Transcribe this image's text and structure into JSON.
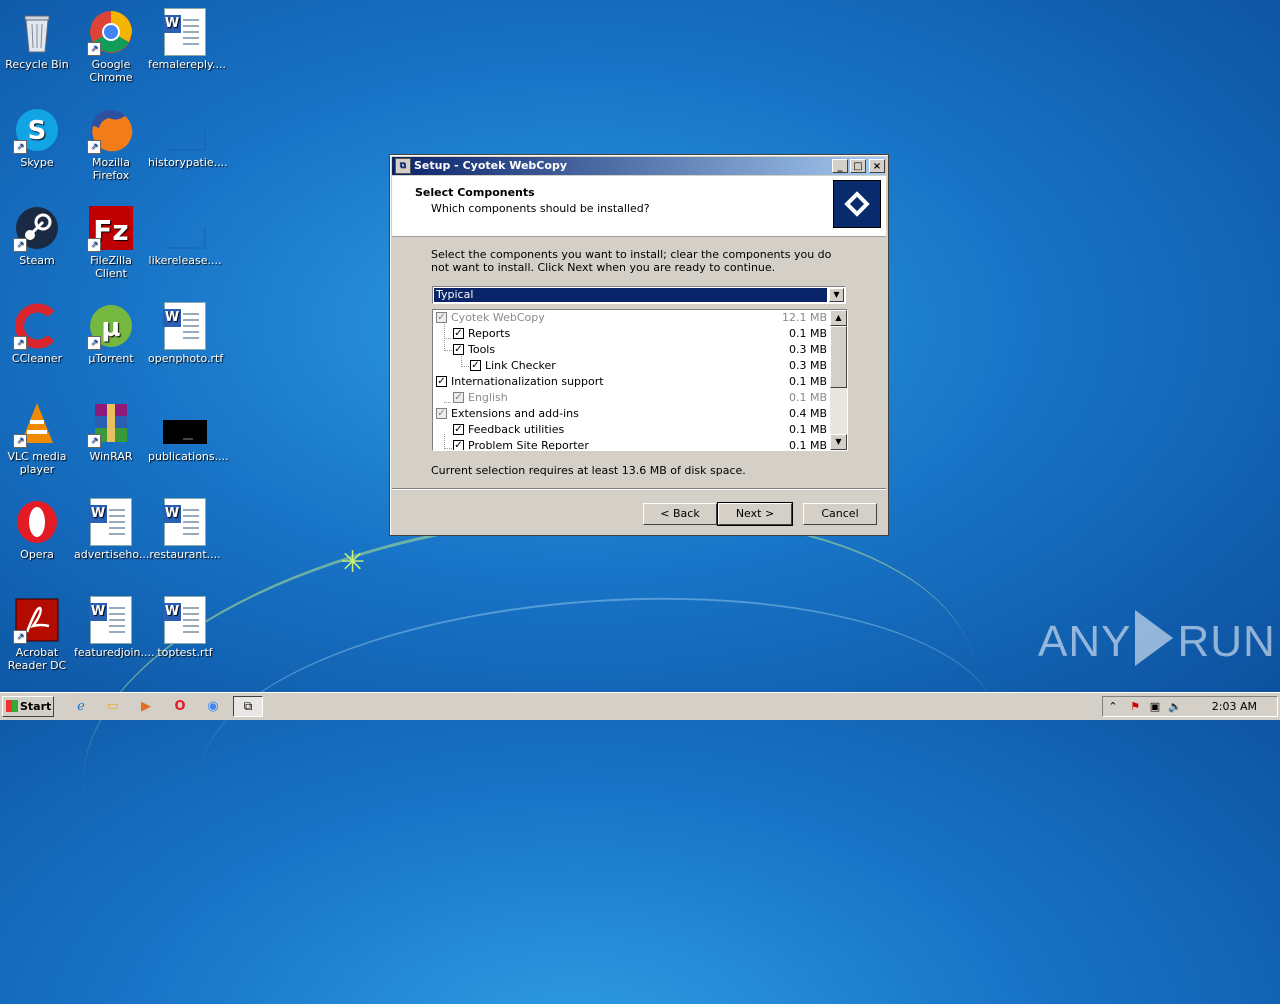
{
  "desktop": {
    "icons": [
      {
        "label": "Recycle Bin",
        "icon": "recycle-bin-icon"
      },
      {
        "label": "Google Chrome",
        "icon": "chrome-icon"
      },
      {
        "label": "femalereply....",
        "icon": "word-doc-icon"
      },
      {
        "label": "Skype",
        "icon": "skype-icon"
      },
      {
        "label": "Mozilla Firefox",
        "icon": "firefox-icon"
      },
      {
        "label": "historypatie....",
        "icon": "blank-file-icon"
      },
      {
        "label": "Steam",
        "icon": "steam-icon"
      },
      {
        "label": "FileZilla Client",
        "icon": "filezilla-icon"
      },
      {
        "label": "likerelease....",
        "icon": "blank-file-icon"
      },
      {
        "label": "CCleaner",
        "icon": "ccleaner-icon"
      },
      {
        "label": "µTorrent",
        "icon": "utorrent-icon"
      },
      {
        "label": "openphoto.rtf",
        "icon": "word-doc-icon"
      },
      {
        "label": "VLC media player",
        "icon": "vlc-icon"
      },
      {
        "label": "WinRAR",
        "icon": "winrar-icon"
      },
      {
        "label": "publications....",
        "icon": "black-file-icon"
      },
      {
        "label": "Opera",
        "icon": "opera-icon"
      },
      {
        "label": "advertiseho....",
        "icon": "word-doc-icon"
      },
      {
        "label": "restaurant....",
        "icon": "word-doc-icon"
      },
      {
        "label": "Acrobat Reader DC",
        "icon": "acrobat-icon"
      },
      {
        "label": "featuredjoin....",
        "icon": "word-doc-icon"
      },
      {
        "label": "toptest.rtf",
        "icon": "word-doc-icon"
      }
    ]
  },
  "dialog": {
    "title": "Setup - Cyotek WebCopy",
    "heading": "Select Components",
    "subheading": "Which components should be installed?",
    "description": "Select the components you want to install; clear the components you do not want to install. Click Next when you are ready to continue.",
    "setup_type": "Typical",
    "components": [
      {
        "name": "Cyotek WebCopy",
        "size": "12.1 MB",
        "checked": true,
        "disabled": true
      },
      {
        "name": "Reports",
        "size": "0.1 MB",
        "checked": true,
        "disabled": false
      },
      {
        "name": "Tools",
        "size": "0.3 MB",
        "checked": true,
        "disabled": false
      },
      {
        "name": "Link Checker",
        "size": "0.3 MB",
        "checked": true,
        "disabled": false
      },
      {
        "name": "Internationalization support",
        "size": "0.1 MB",
        "checked": true,
        "disabled": false
      },
      {
        "name": "English",
        "size": "0.1 MB",
        "checked": true,
        "disabled": true
      },
      {
        "name": "Extensions and add-ins",
        "size": "0.4 MB",
        "checked": true,
        "disabled": false
      },
      {
        "name": "Feedback utilities",
        "size": "0.1 MB",
        "checked": true,
        "disabled": false
      },
      {
        "name": "Problem Site Reporter",
        "size": "0.1 MB",
        "checked": true,
        "disabled": false
      }
    ],
    "disk_space": "Current selection requires at least 13.6 MB of disk space.",
    "buttons": {
      "back": "< Back",
      "next": "Next >",
      "cancel": "Cancel"
    },
    "titlebar_buttons": {
      "minimize": "_",
      "maximize": "□",
      "close": "×"
    }
  },
  "taskbar": {
    "start_label": "Start",
    "clock": "2:03 AM"
  },
  "watermark": {
    "left": "ANY",
    "right": "RUN"
  }
}
